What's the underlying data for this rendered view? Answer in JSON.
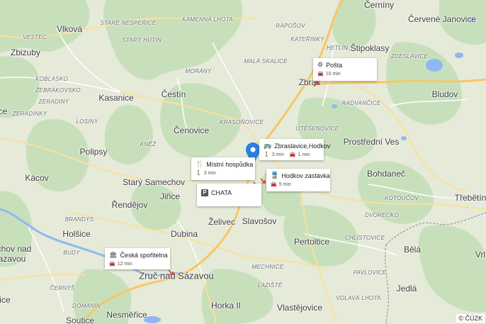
{
  "map": {
    "attribution": "© ČÚZK",
    "towns": [
      {
        "id": "cerniny",
        "text": "Černíny"
      },
      {
        "id": "cervene-janovice",
        "text": "Červené Janovice"
      },
      {
        "id": "vlkova",
        "text": "Vlková"
      },
      {
        "id": "zbizuby",
        "text": "Zbizuby"
      },
      {
        "id": "stipoklasy",
        "text": "Štipoklasy"
      },
      {
        "id": "kasanice",
        "text": "Kasanice"
      },
      {
        "id": "cestin",
        "text": "Čestín"
      },
      {
        "id": "bludov",
        "text": "Bludov"
      },
      {
        "id": "cenovice",
        "text": "Čenovice"
      },
      {
        "id": "polipsy",
        "text": "Polipsy"
      },
      {
        "id": "prostredni-ves",
        "text": "Prostřední Ves"
      },
      {
        "id": "kacov",
        "text": "Kácov"
      },
      {
        "id": "stary-samechov",
        "text": "Starý Samechov"
      },
      {
        "id": "bohdanec",
        "text": "Bohdaneč"
      },
      {
        "id": "rendejov",
        "text": "Řendějov"
      },
      {
        "id": "jirice",
        "text": "Jiřice"
      },
      {
        "id": "trebetin",
        "text": "Třebětín"
      },
      {
        "id": "holsice",
        "text": "Holšice"
      },
      {
        "id": "dubina",
        "text": "Dubina"
      },
      {
        "id": "zelivec",
        "text": "Želivec"
      },
      {
        "id": "slavosov",
        "text": "Slavošov"
      },
      {
        "id": "pertoltice",
        "text": "Pertoltice"
      },
      {
        "id": "bela",
        "text": "Bělá"
      },
      {
        "id": "chov-nad",
        "text": "chov nad"
      },
      {
        "id": "azavou",
        "text": "azavou"
      },
      {
        "id": "zruc-nad-sazavou",
        "text": "Zruč nad Sázavou"
      },
      {
        "id": "jedla",
        "text": "Jedlá"
      },
      {
        "id": "nesmerice",
        "text": "Nesměřice"
      },
      {
        "id": "horka-ii",
        "text": "Horka II"
      },
      {
        "id": "vlastejovice",
        "text": "Vlastějovice"
      },
      {
        "id": "soutice",
        "text": "Soutice"
      },
      {
        "id": "vrl",
        "text": "Vrl"
      },
      {
        "id": "ce",
        "text": "ce"
      },
      {
        "id": "ice",
        "text": "ice"
      },
      {
        "id": "zbrasl",
        "text": "Zbras"
      }
    ],
    "localities": [
      {
        "id": "stare-nespirice",
        "text": "Staré Nespeřice"
      },
      {
        "id": "kamenna-lhota",
        "text": "Kamenná Lhota"
      },
      {
        "id": "raposov",
        "text": "Rápošov"
      },
      {
        "id": "vestec",
        "text": "Vestec"
      },
      {
        "id": "stary-hutin",
        "text": "Starý Hutín"
      },
      {
        "id": "katerinky",
        "text": "Kateřinky"
      },
      {
        "id": "zdeslavice",
        "text": "Zdeslavice"
      },
      {
        "id": "koblasko",
        "text": "Koblasko"
      },
      {
        "id": "mala-skalice",
        "text": "Malá Skalice"
      },
      {
        "id": "morany",
        "text": "Morány"
      },
      {
        "id": "zebrakovsko",
        "text": "Žebrákovsko"
      },
      {
        "id": "zeradiny",
        "text": "Zeradiny"
      },
      {
        "id": "radvancice",
        "text": "Radvančice"
      },
      {
        "id": "zeradinky",
        "text": "Zeradinky"
      },
      {
        "id": "losiny",
        "text": "Losiny"
      },
      {
        "id": "krasonovice",
        "text": "Krasoňovice"
      },
      {
        "id": "utesenovice",
        "text": "Útěšenovice"
      },
      {
        "id": "knez",
        "text": "Kněž"
      },
      {
        "id": "kotoucov",
        "text": "Kotoučov"
      },
      {
        "id": "brandys",
        "text": "Brandýs"
      },
      {
        "id": "dvorecko",
        "text": "Dvorecko"
      },
      {
        "id": "chlistovice",
        "text": "Chlístovice"
      },
      {
        "id": "mechnice",
        "text": "Mechnice"
      },
      {
        "id": "budy",
        "text": "Budy"
      },
      {
        "id": "lazistE",
        "text": "Laziště"
      },
      {
        "id": "pavlovice",
        "text": "Pavlovice"
      },
      {
        "id": "cerny",
        "text": "Černýš"
      },
      {
        "id": "volava-lhota",
        "text": "Volavá Lhota"
      },
      {
        "id": "hetlin",
        "text": "Hetlín"
      },
      {
        "id": "domanin",
        "text": "Domanín"
      }
    ],
    "cards": [
      {
        "id": "posta",
        "name": "Pošta",
        "icon": "post-office-icon",
        "mode": "drive",
        "time": "10 min"
      },
      {
        "id": "zbraslavice-hodkov",
        "name": "Zbraslavice,Hodkov",
        "icon": "bus-stop-icon",
        "walk_time": "3 min",
        "drive_time": "1 min"
      },
      {
        "id": "mistni-hospudka",
        "name": "Místní hospůdka",
        "icon": "restaurant-icon",
        "mode": "walk",
        "time": "3 min"
      },
      {
        "id": "hodkov-zastavka",
        "name": "Hodkov zastávka",
        "icon": "train-icon",
        "mode": "drive",
        "time": "5 min"
      },
      {
        "id": "chata",
        "name": "CHATA",
        "icon": "parking-icon",
        "badge": "P"
      },
      {
        "id": "ceska-sporitelna",
        "name": "Česká spořitelna",
        "icon": "bank-icon",
        "mode": "drive",
        "time": "12 min"
      }
    ],
    "colors": {
      "land": "#e6ead9",
      "forest": "#c5dfb9",
      "water": "#8fb8f2",
      "road": "#fbe09a",
      "major_road": "#f7c86b",
      "border": "#8a8a8a",
      "pin": "#2b7de1"
    }
  }
}
